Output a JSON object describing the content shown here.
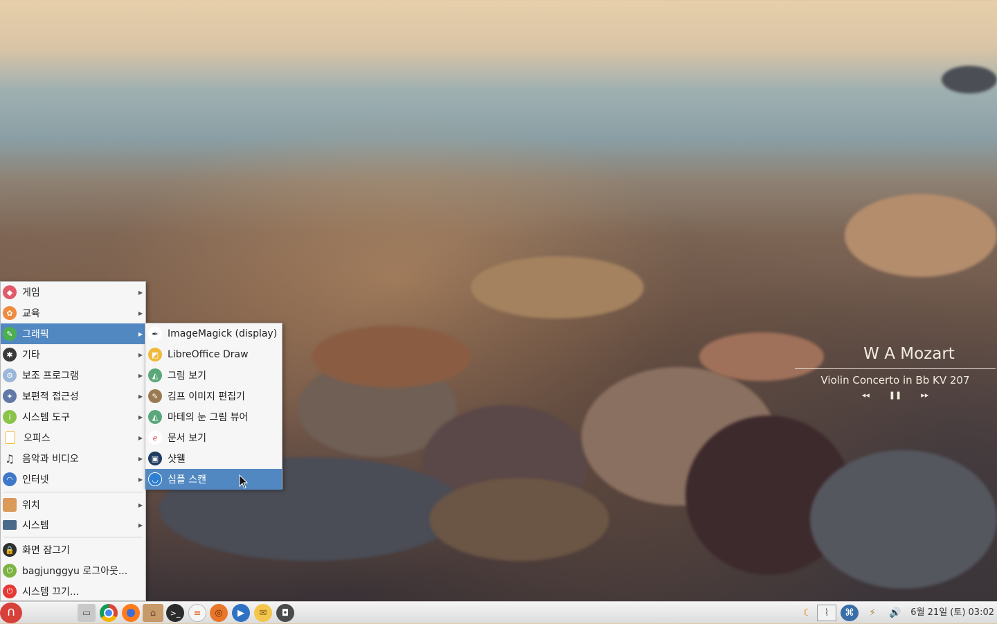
{
  "colors": {
    "selection": "#5288c1",
    "menu_bg": "#f6f6f6",
    "panel_bg": "#e6e6e6"
  },
  "main_menu": {
    "items": [
      {
        "label": "게임",
        "icon": "gamepad-icon",
        "has_submenu": true
      },
      {
        "label": "교육",
        "icon": "education-icon",
        "has_submenu": true
      },
      {
        "label": "그래픽",
        "icon": "graphics-icon",
        "has_submenu": true,
        "selected": true
      },
      {
        "label": "기타",
        "icon": "other-icon",
        "has_submenu": true
      },
      {
        "label": "보조 프로그램",
        "icon": "accessories-icon",
        "has_submenu": true
      },
      {
        "label": "보편적 접근성",
        "icon": "accessibility-icon",
        "has_submenu": true
      },
      {
        "label": "시스템 도구",
        "icon": "system-tools-icon",
        "has_submenu": true
      },
      {
        "label": "오피스",
        "icon": "office-icon",
        "has_submenu": true
      },
      {
        "label": "음악과 비디오",
        "icon": "music-icon",
        "has_submenu": true
      },
      {
        "label": "인터넷",
        "icon": "internet-icon",
        "has_submenu": true
      }
    ],
    "places": [
      {
        "label": "위치",
        "icon": "folder-icon",
        "has_submenu": true
      },
      {
        "label": "시스템",
        "icon": "monitor-icon",
        "has_submenu": true
      }
    ],
    "actions": [
      {
        "label": "화면 잠그기",
        "icon": "lock-screen-icon"
      },
      {
        "label": "bagjunggyu 로그아웃...",
        "icon": "logout-icon"
      },
      {
        "label": "시스템 끄기...",
        "icon": "power-icon"
      }
    ]
  },
  "graphics_submenu": {
    "items": [
      {
        "label": "ImageMagick (display)",
        "icon": "imagemagick-icon"
      },
      {
        "label": "LibreOffice Draw",
        "icon": "libreoffice-draw-icon"
      },
      {
        "label": "그림 보기",
        "icon": "image-viewer-icon"
      },
      {
        "label": "김프 이미지 편집기",
        "icon": "gimp-icon"
      },
      {
        "label": "마테의 눈 그림 뷰어",
        "icon": "eye-of-mate-icon"
      },
      {
        "label": "문서 보기",
        "icon": "document-viewer-icon"
      },
      {
        "label": "샷웰",
        "icon": "shotwell-icon"
      },
      {
        "label": "심플 스캔",
        "icon": "simple-scan-icon",
        "selected": true
      }
    ]
  },
  "music_widget": {
    "artist": "W A Mozart",
    "track": "Violin Concerto in Bb KV 207",
    "prev": "◂◂",
    "pause": "❚❚",
    "next": "▸▸"
  },
  "panel": {
    "menu_icon": "∩",
    "launchers": [
      {
        "name": "show-desktop-icon",
        "glyph": "▭"
      },
      {
        "name": "chrome-icon",
        "glyph": "◉"
      },
      {
        "name": "firefox-icon",
        "glyph": "◍"
      },
      {
        "name": "file-manager-icon",
        "glyph": "⌂"
      },
      {
        "name": "terminal-icon",
        "glyph": ">_"
      },
      {
        "name": "text-editor-icon",
        "glyph": "≡"
      },
      {
        "name": "basketball-icon",
        "glyph": "◎"
      },
      {
        "name": "media-player-icon",
        "glyph": "▶"
      },
      {
        "name": "mail-icon",
        "glyph": "✉"
      },
      {
        "name": "screenshot-icon",
        "glyph": "◘"
      }
    ],
    "tray": [
      {
        "name": "weather-icon",
        "glyph": "☾"
      },
      {
        "name": "system-monitor-icon",
        "glyph": "⌇"
      },
      {
        "name": "network-icon",
        "glyph": "⌘"
      },
      {
        "name": "power-cord-icon",
        "glyph": "⚡"
      },
      {
        "name": "volume-icon",
        "glyph": "🔊"
      }
    ],
    "clock": "6월 21일 (토) 03:02"
  }
}
